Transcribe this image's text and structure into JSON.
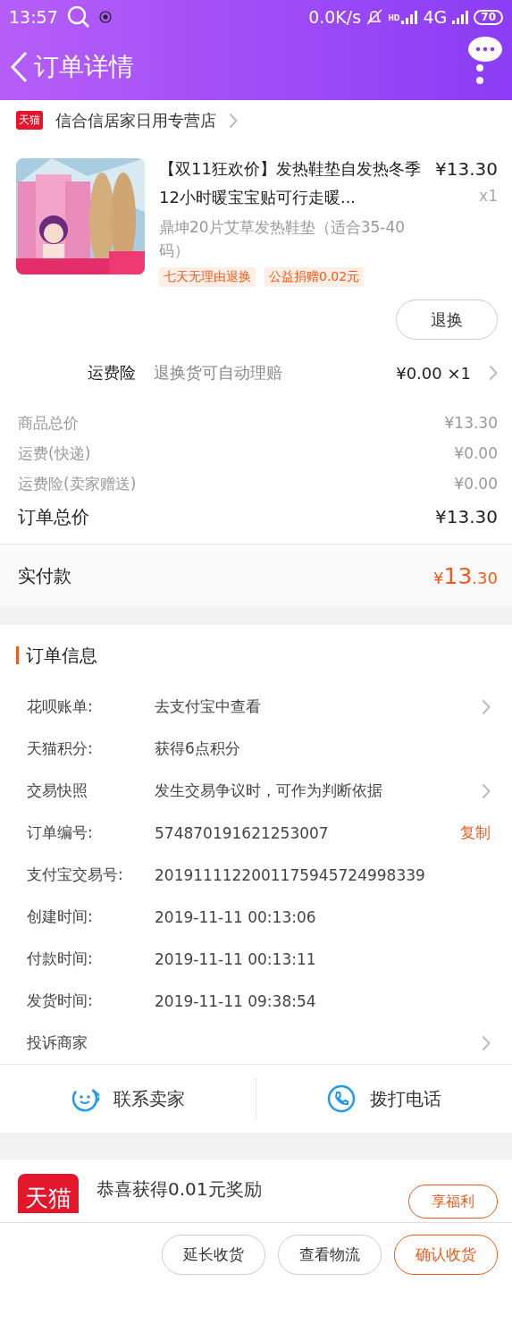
{
  "status_bar": {
    "time": "13:57",
    "network_speed": "0.0K/s",
    "hd_label": "HD",
    "network_type": "4G",
    "battery": "70"
  },
  "header": {
    "title": "订单详情"
  },
  "store": {
    "badge": "天猫",
    "name": "信合信居家日用专营店"
  },
  "product": {
    "kind": "picture",
    "title": "【双11狂欢价】发热鞋垫自发热冬季12小时暖宝宝贴可行走暖...",
    "price": "¥13.30",
    "quantity": "x1",
    "sku": "鼎坤20片艾草发热鞋垫（适合35-40码）",
    "tags": [
      "七天无理由退换",
      "公益捐赠0.02元"
    ],
    "action": "退换"
  },
  "insurance": {
    "label": "运费险",
    "description": "退换货可自动理赔",
    "price": "¥0.00 ×1"
  },
  "fees": [
    {
      "label": "商品总价",
      "value": "¥13.30"
    },
    {
      "label": "运费(快递)",
      "value": "¥0.00"
    },
    {
      "label": "运费险(卖家赠送)",
      "value": "¥0.00"
    }
  ],
  "order_total": {
    "label": "订单总价",
    "value": "¥13.30"
  },
  "paid": {
    "label": "实付款",
    "currency": "¥",
    "amount": "13",
    "decimals": ".30"
  },
  "order_info": {
    "title": "订单信息",
    "rows": [
      {
        "label": "花呗账单:",
        "value": "去支付宝中查看",
        "arrow": true
      },
      {
        "label": "天猫积分:",
        "value": "获得6点积分",
        "arrow": false
      },
      {
        "label": "交易快照",
        "value": "发生交易争议时，可作为判断依据",
        "arrow": true
      },
      {
        "label": "订单编号:",
        "value": "574870191621253007",
        "arrow": false,
        "action": "复制"
      },
      {
        "label": "支付宝交易号:",
        "value": "2019111122001175945724998339",
        "arrow": false
      },
      {
        "label": "创建时间:",
        "value": "2019-11-11 00:13:06",
        "arrow": false
      },
      {
        "label": "付款时间:",
        "value": "2019-11-11 00:13:11",
        "arrow": false
      },
      {
        "label": "发货时间:",
        "value": "2019-11-11 09:38:54",
        "arrow": false
      },
      {
        "label": "投诉商家",
        "arrow": true
      }
    ]
  },
  "contacts": [
    {
      "kind": "chat",
      "label": "联系卖家"
    },
    {
      "kind": "phone",
      "label": "拨打电话"
    }
  ],
  "reward": {
    "badge": "天猫",
    "text": "恭喜获得0.01元奖励",
    "button": "享福利"
  },
  "bottom_buttons": [
    {
      "label": "延长收货",
      "primary": false
    },
    {
      "label": "查看物流",
      "primary": false
    },
    {
      "label": "确认收货",
      "primary": true
    }
  ]
}
